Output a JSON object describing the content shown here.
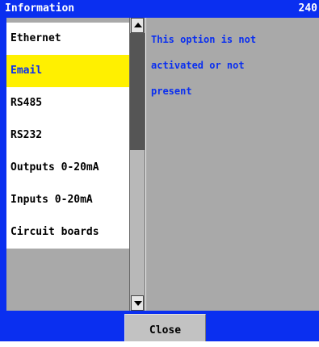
{
  "window": {
    "title": "Information",
    "number": "240"
  },
  "menu": {
    "items": [
      {
        "label": "Ethernet",
        "selected": false
      },
      {
        "label": "Email",
        "selected": true
      },
      {
        "label": "RS485",
        "selected": false
      },
      {
        "label": "RS232",
        "selected": false
      },
      {
        "label": "Outputs 0-20mA",
        "selected": false
      },
      {
        "label": "Inputs 0-20mA",
        "selected": false
      },
      {
        "label": "Circuit boards",
        "selected": false
      }
    ]
  },
  "scrollbar": {
    "up_icon": "arrow-up-icon",
    "down_icon": "arrow-down-icon"
  },
  "detail": {
    "lines": [
      "This option is not",
      "activated or not",
      "present"
    ]
  },
  "footer": {
    "close_label": "Close"
  },
  "colors": {
    "accent": "#0a2ff0",
    "selected_bg": "#fff000",
    "panel_bg": "#a9a9a9"
  }
}
